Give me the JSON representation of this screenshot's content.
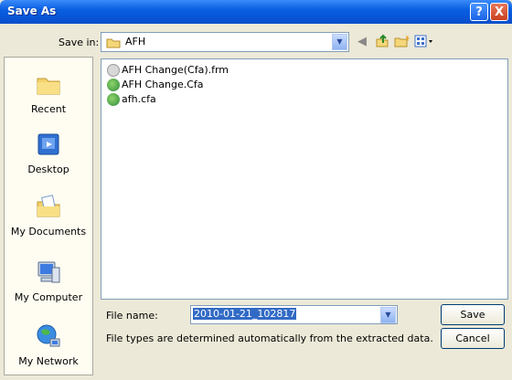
{
  "window": {
    "title": "Save As"
  },
  "titlebar": {
    "help_label": "?",
    "close_label": "X"
  },
  "save_in": {
    "label": "Save in:",
    "value": "AFH"
  },
  "toolbar": {
    "back_icon": "back-icon",
    "up_icon": "up-folder-icon",
    "new_folder_icon": "new-folder-icon",
    "views_icon": "views-menu-icon"
  },
  "places": [
    {
      "label": "Recent",
      "icon": "recent-icon"
    },
    {
      "label": "Desktop",
      "icon": "desktop-icon"
    },
    {
      "label": "My Documents",
      "icon": "my-documents-icon"
    },
    {
      "label": "My Computer",
      "icon": "my-computer-icon"
    },
    {
      "label": "My Network",
      "icon": "my-network-icon"
    }
  ],
  "files": [
    {
      "name": "AFH Change(Cfa).frm",
      "icon": "frm-file-icon"
    },
    {
      "name": "AFH Change.Cfa",
      "icon": "cfa-file-icon"
    },
    {
      "name": "afh.cfa",
      "icon": "cfa-file-icon"
    }
  ],
  "file_name": {
    "label": "File name:",
    "value": "2010-01-21_102817"
  },
  "file_types": {
    "label": "File types are determined automatically from the extracted data."
  },
  "buttons": {
    "save": "Save",
    "cancel": "Cancel"
  },
  "colors": {
    "titlebar": "#0756d8",
    "selection": "#316ac5",
    "dialog_bg": "#ece9d8"
  }
}
